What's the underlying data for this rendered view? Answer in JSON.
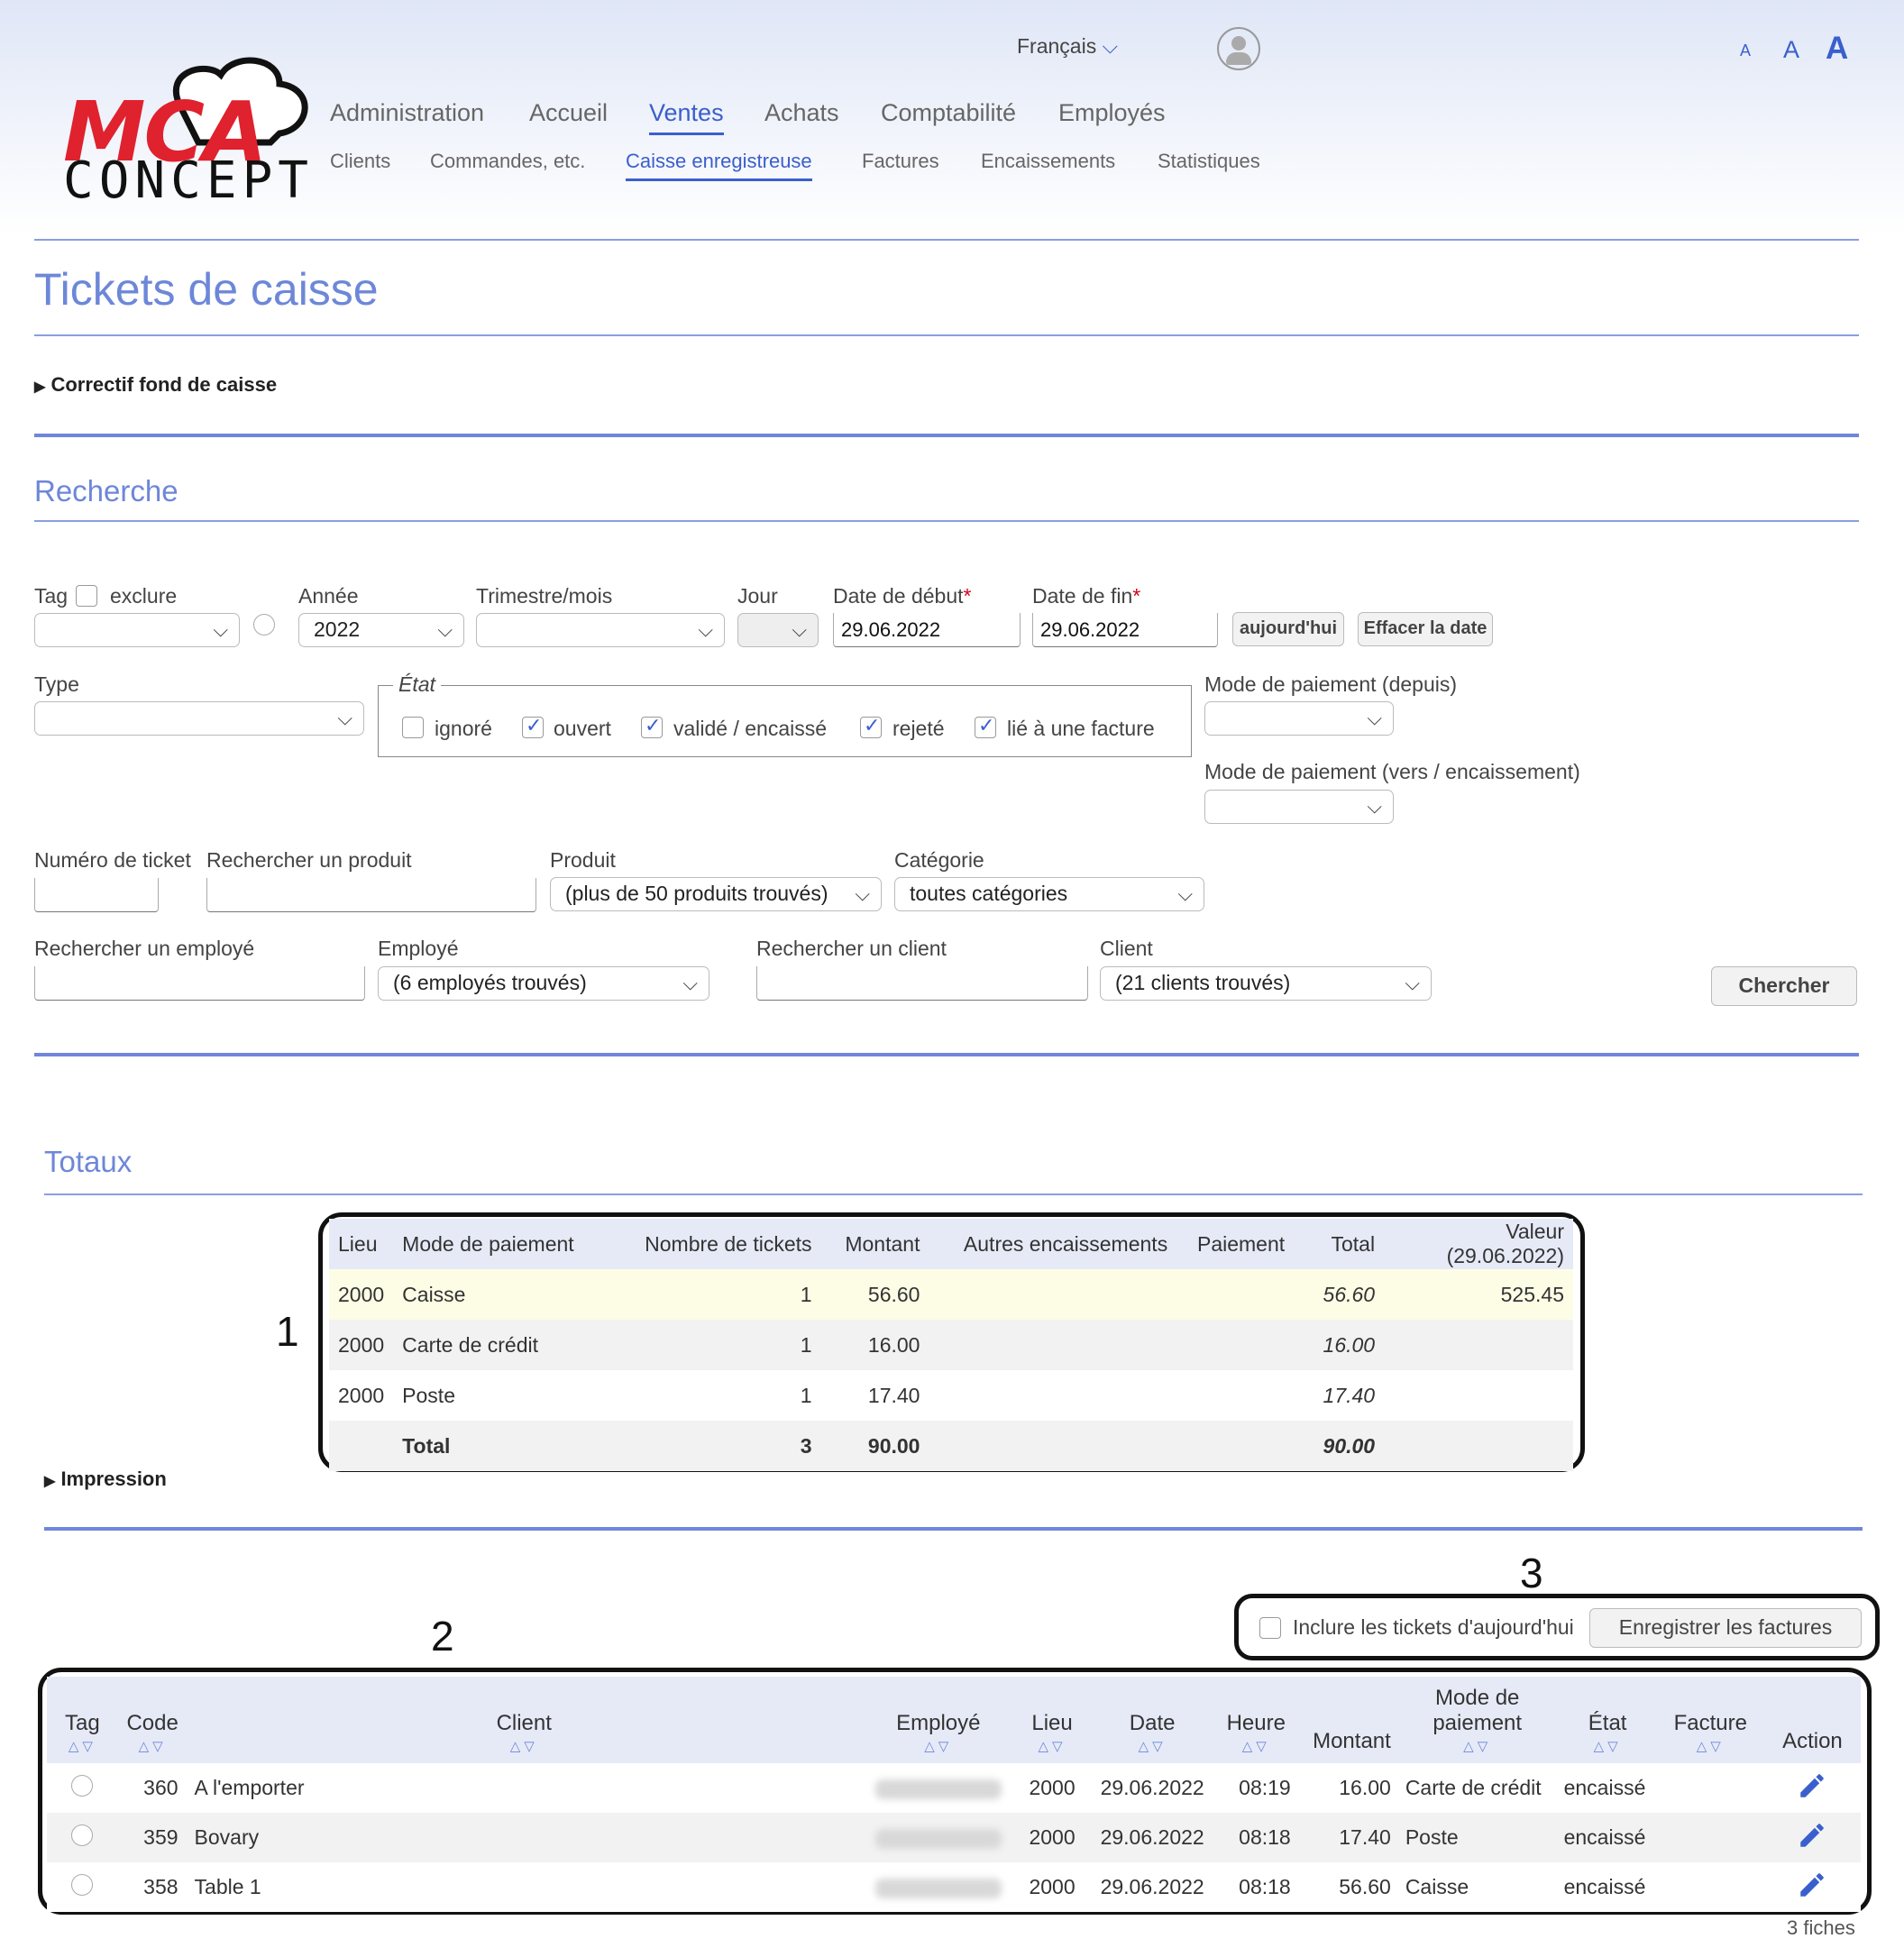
{
  "logo": {
    "line1": "MCA",
    "line2": "CONCEPT"
  },
  "header": {
    "language": "Français",
    "font_sizes": [
      "A",
      "A",
      "A"
    ],
    "nav_main": [
      "Administration",
      "Accueil",
      "Ventes",
      "Achats",
      "Comptabilité",
      "Employés"
    ],
    "nav_sub": [
      "Clients",
      "Commandes, etc.",
      "Caisse enregistreuse",
      "Factures",
      "Encaissements",
      "Statistiques"
    ]
  },
  "page": {
    "title": "Tickets de caisse",
    "correctif": "Correctif fond de caisse",
    "recherche": "Recherche",
    "totaux": "Totaux",
    "impression": "Impression"
  },
  "search": {
    "tag_label": "Tag",
    "exclude_label": "exclure",
    "annee_label": "Année",
    "annee_value": "2022",
    "trimestre_label": "Trimestre/mois",
    "jour_label": "Jour",
    "date_debut_label": "Date de début",
    "date_debut_value": "29.06.2022",
    "date_fin_label": "Date de fin",
    "date_fin_value": "29.06.2022",
    "required_mark": "*",
    "today_button": "aujourd'hui",
    "clear_date_button": "Effacer la date",
    "type_label": "Type",
    "etat_label": "État",
    "etat_options": [
      "ignoré",
      "ouvert",
      "validé / encaissé",
      "rejeté",
      "lié à une facture"
    ],
    "mode_depuis_label": "Mode de paiement (depuis)",
    "mode_vers_label": "Mode de paiement (vers / encaissement)",
    "numero_ticket_label": "Numéro de ticket",
    "rechercher_produit_label": "Rechercher un produit",
    "produit_label": "Produit",
    "produit_value": "(plus de 50 produits trouvés)",
    "categorie_label": "Catégorie",
    "categorie_value": "toutes catégories",
    "rechercher_employe_label": "Rechercher un employé",
    "employe_label": "Employé",
    "employe_value": "(6 employés trouvés)",
    "rechercher_client_label": "Rechercher un client",
    "client_label": "Client",
    "client_value": "(21 clients trouvés)",
    "search_button": "Chercher",
    "chevron": "⌵"
  },
  "totals": {
    "headers": [
      "Lieu",
      "Mode de paiement",
      "Nombre de tickets",
      "Montant",
      "Autres encaissements",
      "Paiement",
      "Total",
      "Valeur (29.06.2022)"
    ],
    "rows": [
      [
        "2000",
        "Caisse",
        "1",
        "56.60",
        "",
        "",
        "56.60",
        "525.45"
      ],
      [
        "2000",
        "Carte de crédit",
        "1",
        "16.00",
        "",
        "",
        "16.00",
        ""
      ],
      [
        "2000",
        "Poste",
        "1",
        "17.40",
        "",
        "",
        "17.40",
        ""
      ]
    ],
    "total_row": [
      "",
      "Total",
      "3",
      "90.00",
      "",
      "",
      "90.00",
      ""
    ]
  },
  "actions": {
    "include_today_label": "Inclure les tickets d'aujourd'hui",
    "save_invoices_button": "Enregistrer les factures"
  },
  "tickets": {
    "headers": [
      "Tag",
      "Code",
      "Client",
      "Employé",
      "Lieu",
      "Date",
      "Heure",
      "Montant",
      "Mode de paiement",
      "État",
      "Facture",
      "Action"
    ],
    "sort_asc": "△",
    "sort_desc": "▽",
    "rows": [
      {
        "code": "360",
        "client": "A l'emporter",
        "lieu": "2000",
        "date": "29.06.2022",
        "heure": "08:19",
        "montant": "16.00",
        "mode": "Carte de crédit",
        "etat": "encaissé"
      },
      {
        "code": "359",
        "client": "Bovary",
        "lieu": "2000",
        "date": "29.06.2022",
        "heure": "08:18",
        "montant": "17.40",
        "mode": "Poste",
        "etat": "encaissé"
      },
      {
        "code": "358",
        "client": "Table 1",
        "lieu": "2000",
        "date": "29.06.2022",
        "heure": "08:18",
        "montant": "56.60",
        "mode": "Caisse",
        "etat": "encaissé"
      }
    ],
    "count": "3 fiches"
  },
  "callouts": [
    "1",
    "2",
    "3"
  ],
  "colors": {
    "accent": "#3a5fcd",
    "heading": "#6d87d8",
    "highlight_row": "#fdfde6",
    "header_bg": "#e6eaf7"
  }
}
